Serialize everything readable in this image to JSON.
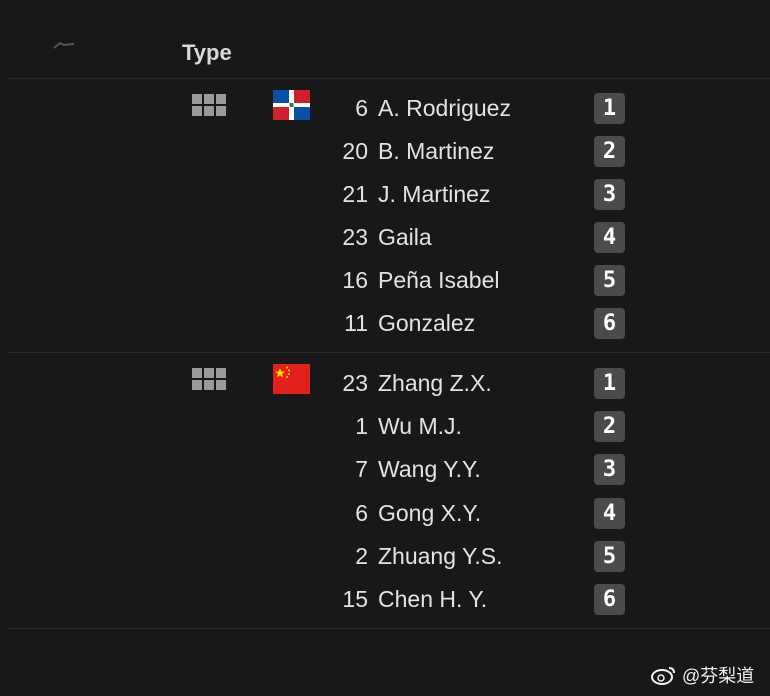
{
  "header": {
    "type_label": "Type"
  },
  "teams": [
    {
      "country": "Dominican Republic",
      "flag_icon": "dominican-republic-flag-icon",
      "formation_icon": "grid-icon",
      "players": [
        {
          "number": "6",
          "name": "A. Rodriguez",
          "position": "1"
        },
        {
          "number": "20",
          "name": "B. Martinez",
          "position": "2"
        },
        {
          "number": "21",
          "name": "J. Martinez",
          "position": "3"
        },
        {
          "number": "23",
          "name": "Gaila",
          "position": "4"
        },
        {
          "number": "16",
          "name": "Peña Isabel",
          "position": "5"
        },
        {
          "number": "11",
          "name": "Gonzalez",
          "position": "6"
        }
      ]
    },
    {
      "country": "China",
      "flag_icon": "china-flag-icon",
      "formation_icon": "grid-icon",
      "players": [
        {
          "number": "23",
          "name": "Zhang Z.X.",
          "position": "1"
        },
        {
          "number": "1",
          "name": "Wu M.J.",
          "position": "2"
        },
        {
          "number": "7",
          "name": "Wang Y.Y.",
          "position": "3"
        },
        {
          "number": "6",
          "name": "Gong X.Y.",
          "position": "4"
        },
        {
          "number": "2",
          "name": "Zhuang Y.S.",
          "position": "5"
        },
        {
          "number": "15",
          "name": "Chen H. Y.",
          "position": "6"
        }
      ]
    }
  ],
  "watermark": {
    "text": "@芬梨道"
  },
  "colors": {
    "background": "#181818",
    "badge": "#4b4b4b",
    "text": "#e3e3e3"
  }
}
